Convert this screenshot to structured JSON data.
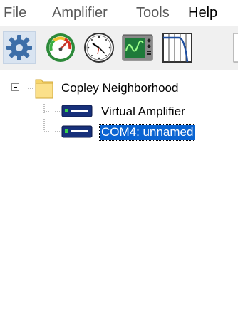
{
  "menu": [
    {
      "label": "File"
    },
    {
      "label": "Amplifier"
    },
    {
      "label": "Tools"
    },
    {
      "label": "Help"
    }
  ],
  "toolbar": {
    "buttons": [
      {
        "name": "settings",
        "icon": "gear-icon"
      },
      {
        "name": "control-panel",
        "icon": "gauge-icon"
      },
      {
        "name": "clock",
        "icon": "clock-icon"
      },
      {
        "name": "scope",
        "icon": "oscilloscope-icon"
      },
      {
        "name": "filter",
        "icon": "filter-response-icon"
      }
    ]
  },
  "tree": {
    "root": {
      "label": "Copley Neighborhood",
      "icon": "folder-icon"
    },
    "children": [
      {
        "label": "Virtual Amplifier",
        "icon": "amplifier-icon"
      },
      {
        "label": "COM4: unnamed",
        "icon": "amplifier-icon",
        "selected": true
      }
    ]
  },
  "colors": {
    "selection": "#0a64d2",
    "menu_text": "#5a5a5a",
    "toolbar_bg": "#f0f0f0"
  }
}
